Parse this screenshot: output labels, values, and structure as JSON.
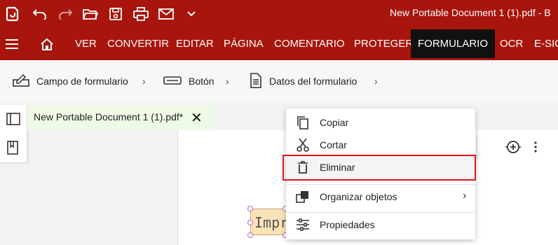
{
  "app": {
    "title": "New Portable Document 1 (1).pdf  -  B"
  },
  "quick_access": [
    {
      "icon": "app-logo-icon"
    },
    {
      "icon": "undo-icon"
    },
    {
      "icon": "redo-icon"
    },
    {
      "icon": "open-folder-icon"
    },
    {
      "icon": "save-icon"
    },
    {
      "icon": "print-icon"
    },
    {
      "icon": "email-icon"
    },
    {
      "icon": "chevron-down-icon"
    }
  ],
  "menu": {
    "items": [
      "VER",
      "CONVERTIR",
      "EDITAR",
      "PÁGINA",
      "COMENTARIO",
      "PROTEGER",
      "FORMULARIO",
      "OCR",
      "E-SIG"
    ],
    "active": "FORMULARIO"
  },
  "ribbon": {
    "items": [
      {
        "label": "Campo de formulario",
        "icon": "form-field-icon"
      },
      {
        "label": "Botón",
        "icon": "button-icon"
      },
      {
        "label": "Datos del formulario",
        "icon": "form-data-icon"
      }
    ],
    "chevron": "›"
  },
  "document_tab": {
    "label": "New Portable Document 1 (1).pdf*",
    "close": "✕"
  },
  "form_field": {
    "text": "Impr"
  },
  "context_menu": {
    "items": [
      {
        "label": "Copiar",
        "icon": "copy-icon"
      },
      {
        "label": "Cortar",
        "icon": "scissors-icon"
      },
      {
        "label": "Eliminar",
        "icon": "trash-icon",
        "highlighted": true
      },
      {
        "label": "Organizar objetos",
        "icon": "arrange-objects-icon",
        "submenu": "›"
      },
      {
        "label": "Propiedades",
        "icon": "properties-icon"
      }
    ]
  },
  "colors": {
    "brand": "#a7150c",
    "active_tab": "#111111",
    "highlight_border": "#e0131a",
    "tab_bg": "#eef9e6"
  }
}
